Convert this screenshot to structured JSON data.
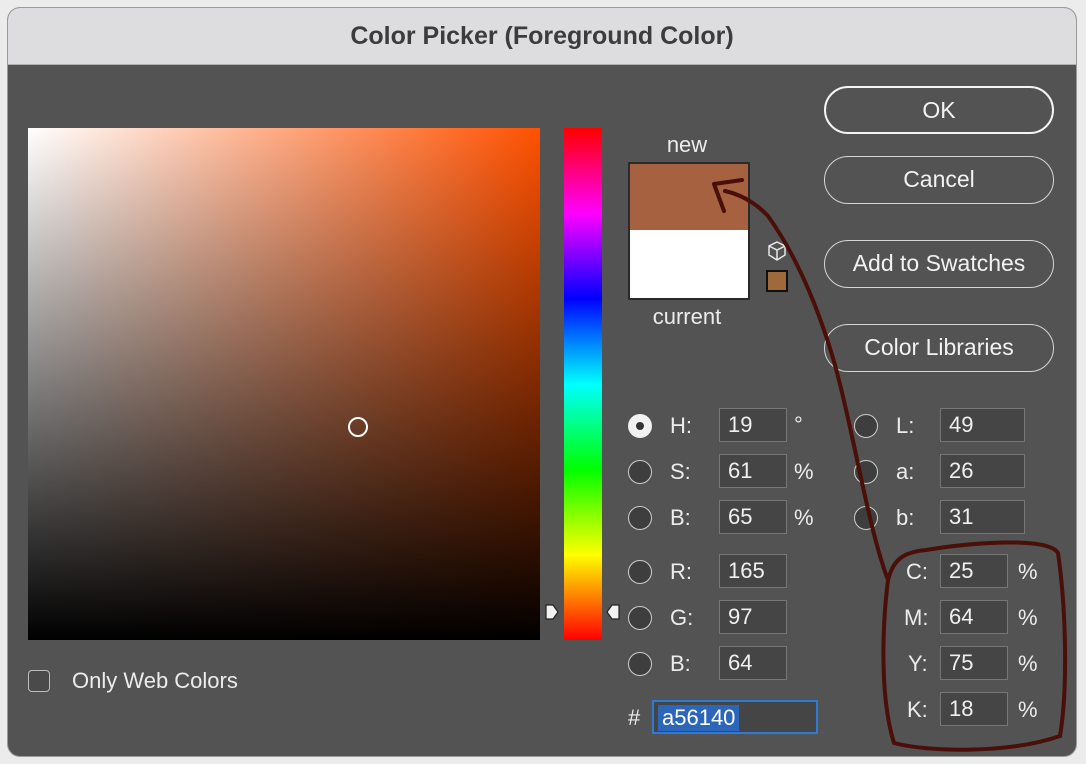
{
  "window": {
    "title": "Color Picker (Foreground Color)"
  },
  "swatches": {
    "new_label": "new",
    "current_label": "current",
    "new_color": "#a56140",
    "current_color": "#ffffff"
  },
  "buttons": {
    "ok": "OK",
    "cancel": "Cancel",
    "add_to_swatches": "Add to Swatches",
    "color_libraries": "Color Libraries"
  },
  "hsb": {
    "h": {
      "label": "H:",
      "value": "19",
      "unit": "°"
    },
    "s": {
      "label": "S:",
      "value": "61",
      "unit": "%"
    },
    "b": {
      "label": "B:",
      "value": "65",
      "unit": "%"
    }
  },
  "rgb": {
    "r": {
      "label": "R:",
      "value": "165"
    },
    "g": {
      "label": "G:",
      "value": "97"
    },
    "b": {
      "label": "B:",
      "value": "64"
    }
  },
  "lab": {
    "l": {
      "label": "L:",
      "value": "49"
    },
    "a": {
      "label": "a:",
      "value": "26"
    },
    "b": {
      "label": "b:",
      "value": "31"
    }
  },
  "cmyk": {
    "c": {
      "label": "C:",
      "value": "25",
      "unit": "%"
    },
    "m": {
      "label": "M:",
      "value": "64",
      "unit": "%"
    },
    "y": {
      "label": "Y:",
      "value": "75",
      "unit": "%"
    },
    "k": {
      "label": "K:",
      "value": "18",
      "unit": "%"
    }
  },
  "hex": {
    "label": "#",
    "value": "a56140"
  },
  "web_colors": {
    "label": "Only Web Colors",
    "checked": false
  },
  "selected_mode": "H",
  "icons": {
    "gamut_warning": "cube-warning-icon",
    "hue_marker": "triangle-marker-icon"
  },
  "colors": {
    "annotation_ink": "#4a0f08",
    "hex_selection": "#2b66b8"
  }
}
